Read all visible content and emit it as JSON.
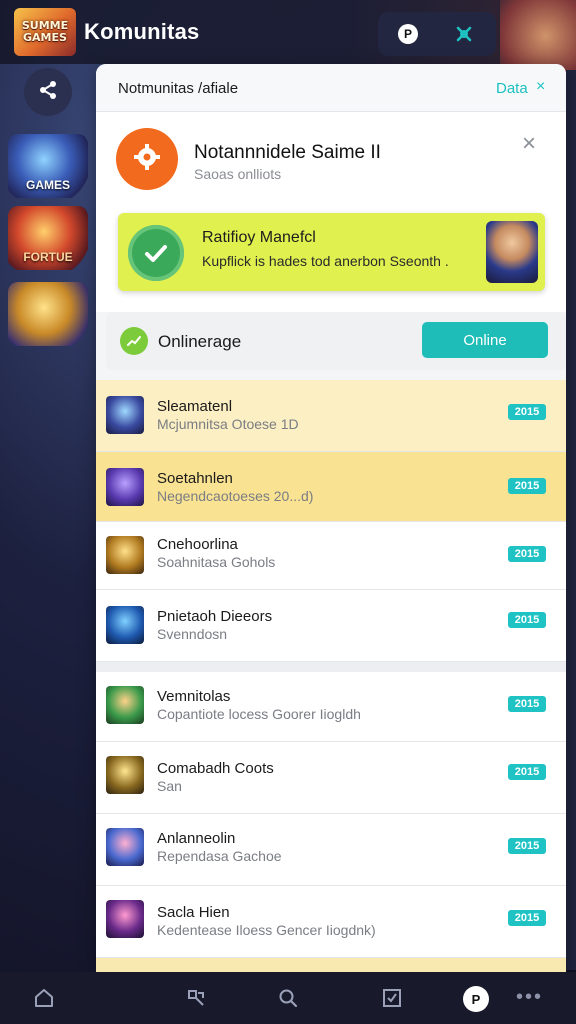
{
  "header": {
    "logo_text": "SUMME\nGAMES",
    "title": "Komunitas",
    "action_a_label": "P"
  },
  "rail": {
    "items": [
      {
        "label": "GAMES"
      },
      {
        "label": "FORTUE"
      },
      {
        "label": ""
      }
    ]
  },
  "panel": {
    "head_title": "Notmunitas /afiale",
    "head_data": "Data",
    "head_close": "×"
  },
  "profile": {
    "name": "Notannnidele Saime II",
    "subtitle": "Saoas onlliots",
    "close": "×"
  },
  "promo": {
    "title": "Ratifioy Manefcl",
    "subtitle": "Kupflick is  hades tod anerbon Sseonth  ."
  },
  "online": {
    "label": "Onlinerage",
    "button": "Online"
  },
  "items": [
    {
      "title": "Sleamatenl",
      "subtitle": "Mcjumnitsa Otoese 1D",
      "badge": "2015",
      "style": "hl-1"
    },
    {
      "title": "Soetahnlen",
      "subtitle": "Negendcaotoeses 20...d)",
      "badge": "2015",
      "style": "hl-2"
    },
    {
      "title": "Cnehoorlina",
      "subtitle": "Soahnitasa Gohols",
      "badge": "2015",
      "style": ""
    },
    {
      "title": "Pnietaoh Dieeors",
      "subtitle": "Svenndosn",
      "badge": "2015",
      "style": ""
    },
    {
      "title": "Vemnitolas",
      "subtitle": "Copantiote locess Goorer Iiogldh",
      "badge": "2015",
      "style": ""
    },
    {
      "title": "Comabadh Coots",
      "subtitle": "San",
      "badge": "2015",
      "style": ""
    },
    {
      "title": "Anlanneolin",
      "subtitle": "Rependasa Gachoe",
      "badge": "2015",
      "style": ""
    },
    {
      "title": "Sacla Hien",
      "subtitle": "Kedentease Iloess Gencer Iiogdnk)",
      "badge": "2015",
      "style": ""
    }
  ],
  "bottom_nav": {
    "avatar_label": "P",
    "more": "•••"
  },
  "colors": {
    "accent": "#1ebdb8",
    "promo": "#dff04f",
    "avatar": "#f26a1d"
  }
}
